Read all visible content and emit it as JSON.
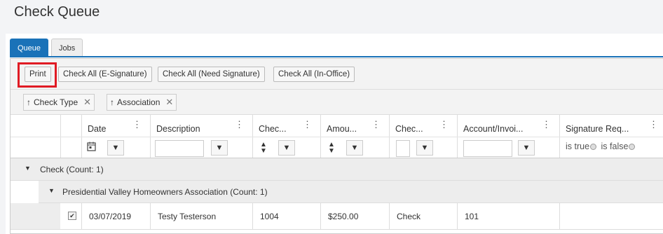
{
  "page": {
    "title": "Check Queue"
  },
  "tabs": [
    {
      "label": "Queue",
      "active": true
    },
    {
      "label": "Jobs",
      "active": false
    }
  ],
  "toolbar": {
    "print": "Print",
    "check_all_esig": "Check All (E-Signature)",
    "check_all_need_sig": "Check All (Need Signature)",
    "check_all_inoffice": "Check All (In-Office)"
  },
  "grouping": [
    {
      "label": "Check Type"
    },
    {
      "label": "Association"
    }
  ],
  "columns": {
    "date": "Date",
    "description": "Description",
    "check": "Chec...",
    "amount": "Amou...",
    "check_type": "Chec...",
    "account": "Account/Invoi...",
    "signature": "Signature Req..."
  },
  "filters": {
    "sig_true": "is true",
    "sig_false": "is false"
  },
  "groups": {
    "level1": "Check (Count: 1)",
    "level2": "Presidential Valley Homeowners Association (Count: 1)"
  },
  "rows": [
    {
      "date": "03/07/2019",
      "description": "Testy Testerson",
      "check": "1004",
      "amount": "$250.00",
      "check_type": "Check",
      "account": "101",
      "checked": true
    }
  ],
  "icons": {
    "sort_up": "arrow-up-icon",
    "remove": "close-icon",
    "filter": "funnel-icon",
    "calendar": "calendar-icon",
    "menu": "kebab-icon"
  },
  "colors": {
    "accent": "#1a72b8",
    "highlight": "#e01b24"
  }
}
